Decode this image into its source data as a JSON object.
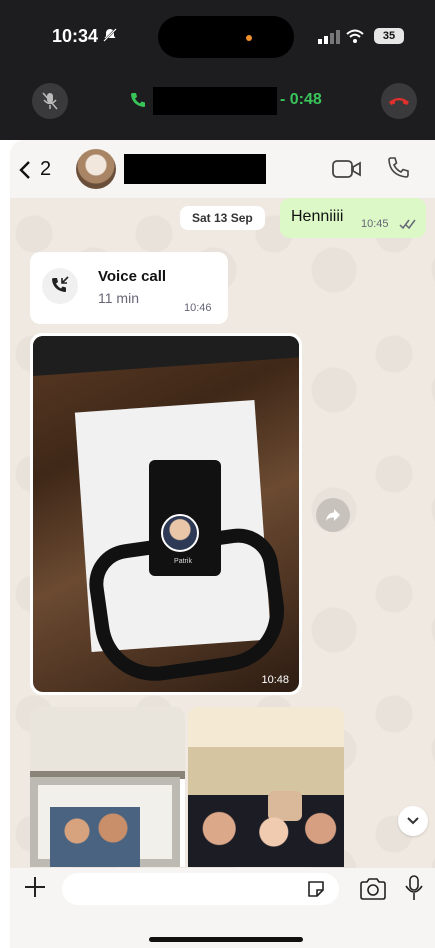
{
  "status_bar": {
    "time": "10:34",
    "battery": "35",
    "icons": [
      "bell-slash-icon",
      "signal-icon",
      "wifi-icon",
      "battery-icon"
    ]
  },
  "call_bar": {
    "timer": "- 0:48",
    "icons": [
      "mic-off-icon",
      "phone-icon",
      "hang-up-icon"
    ],
    "accent_color": "#39c45a",
    "end_color": "#e0302c"
  },
  "header": {
    "back_count": "2",
    "icons": [
      "chevron-left-icon",
      "video-call-icon",
      "phone-call-icon"
    ]
  },
  "messages": {
    "date_label": "Sat 13 Sep",
    "outgoing": {
      "text": "Henniiii",
      "time": "10:45"
    },
    "voice_call": {
      "title": "Voice call",
      "duration": "11 min",
      "time": "10:46"
    },
    "image": {
      "time": "10:48",
      "badge_name": "Patrik"
    }
  },
  "composer": {
    "placeholder": "",
    "icons": [
      "plus-icon",
      "sticker-icon",
      "camera-icon",
      "microphone-icon"
    ]
  },
  "colors": {
    "outgoing_bubble": "#dcf8c6",
    "chat_background": "#efe9e1",
    "dark_top": "#1d1d1f"
  }
}
